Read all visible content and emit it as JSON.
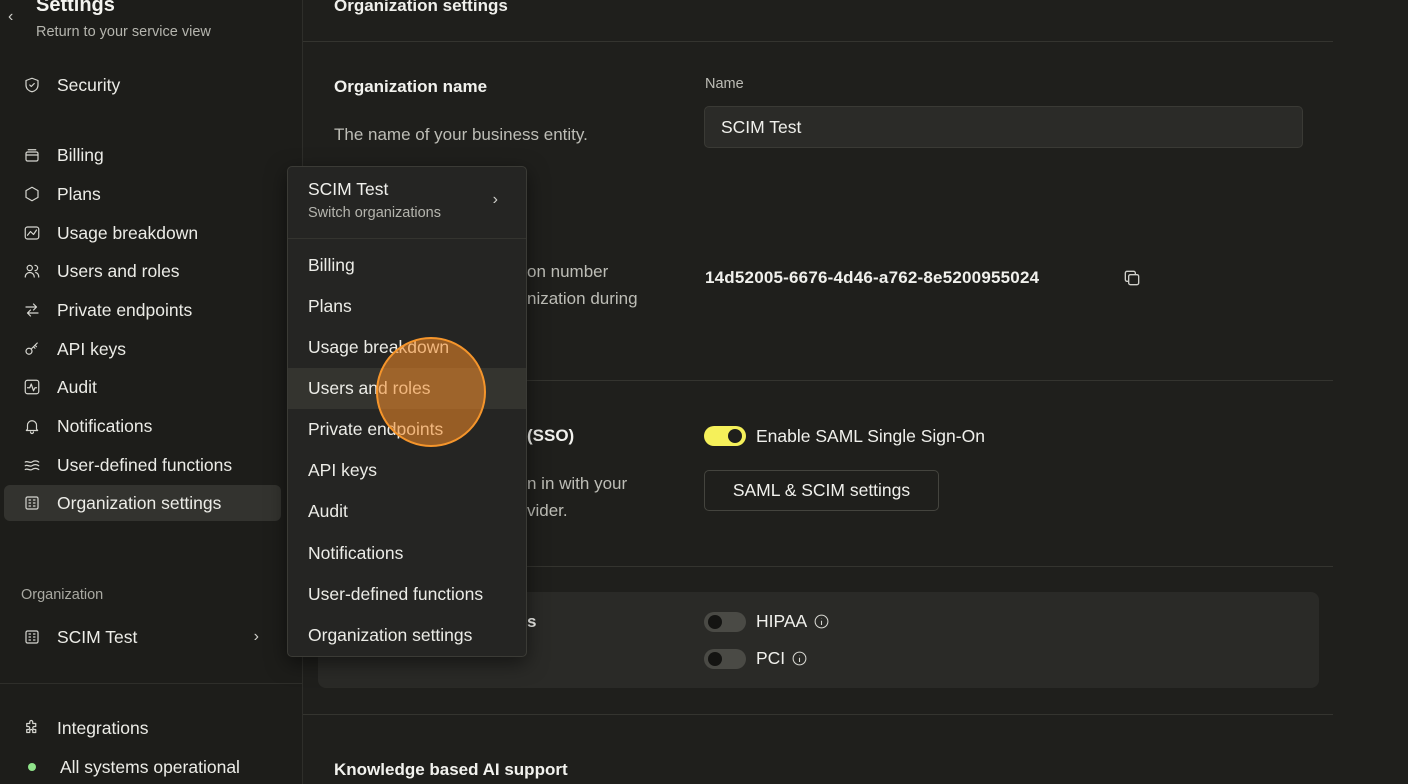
{
  "sidebar": {
    "back_icon": "chevron-left-icon",
    "title": "Settings",
    "subtitle": "Return to your service view",
    "items": [
      {
        "label": "Security",
        "icon": "shield-icon"
      },
      {
        "label": "Billing",
        "icon": "billing-icon"
      },
      {
        "label": "Plans",
        "icon": "hexagon-icon"
      },
      {
        "label": "Usage breakdown",
        "icon": "chart-icon"
      },
      {
        "label": "Users and roles",
        "icon": "users-icon"
      },
      {
        "label": "Private endpoints",
        "icon": "arrows-icon"
      },
      {
        "label": "API keys",
        "icon": "key-icon"
      },
      {
        "label": "Audit",
        "icon": "activity-icon"
      },
      {
        "label": "Notifications",
        "icon": "bell-icon"
      },
      {
        "label": "User-defined functions",
        "icon": "waves-icon"
      },
      {
        "label": "Organization settings",
        "icon": "building-icon",
        "active": true
      }
    ],
    "org_section_label": "Organization",
    "org_name": "SCIM Test",
    "integrations_label": "Integrations",
    "status_label": "All systems operational",
    "status_color": "#8fe38a"
  },
  "main": {
    "title": "Organization settings",
    "org_name_section": {
      "heading": "Organization name",
      "description": "The name of your business entity.",
      "field_label": "Name",
      "field_value": "SCIM Test"
    },
    "org_id_section": {
      "description_line1": "on number",
      "description_line2": "nization during",
      "org_id": "14d52005-6676-4d46-a762-8e5200955024",
      "copy_icon": "copy-icon"
    },
    "sso_section": {
      "heading_fragment": "(SSO)",
      "description_line1": "n in with your",
      "description_line2": "vider.",
      "toggle_label": "Enable SAML Single Sign-On",
      "toggle_on": true,
      "button_label": "SAML & SCIM settings"
    },
    "compliance_section": {
      "heading_fragment": "s",
      "items": [
        {
          "label": "HIPAA",
          "enabled": false
        },
        {
          "label": "PCI",
          "enabled": false
        }
      ]
    },
    "ai_section": {
      "heading": "Knowledge based AI support"
    }
  },
  "dropdown": {
    "org_name": "SCIM Test",
    "switch_label": "Switch organizations",
    "items": [
      "Billing",
      "Plans",
      "Usage breakdown",
      "Users and roles",
      "Private endpoints",
      "API keys",
      "Audit",
      "Notifications",
      "User-defined functions",
      "Organization settings"
    ],
    "hovered_index": 3
  },
  "colors": {
    "accent_toggle": "#f5f05a",
    "click_indicator": "#f5952b"
  }
}
